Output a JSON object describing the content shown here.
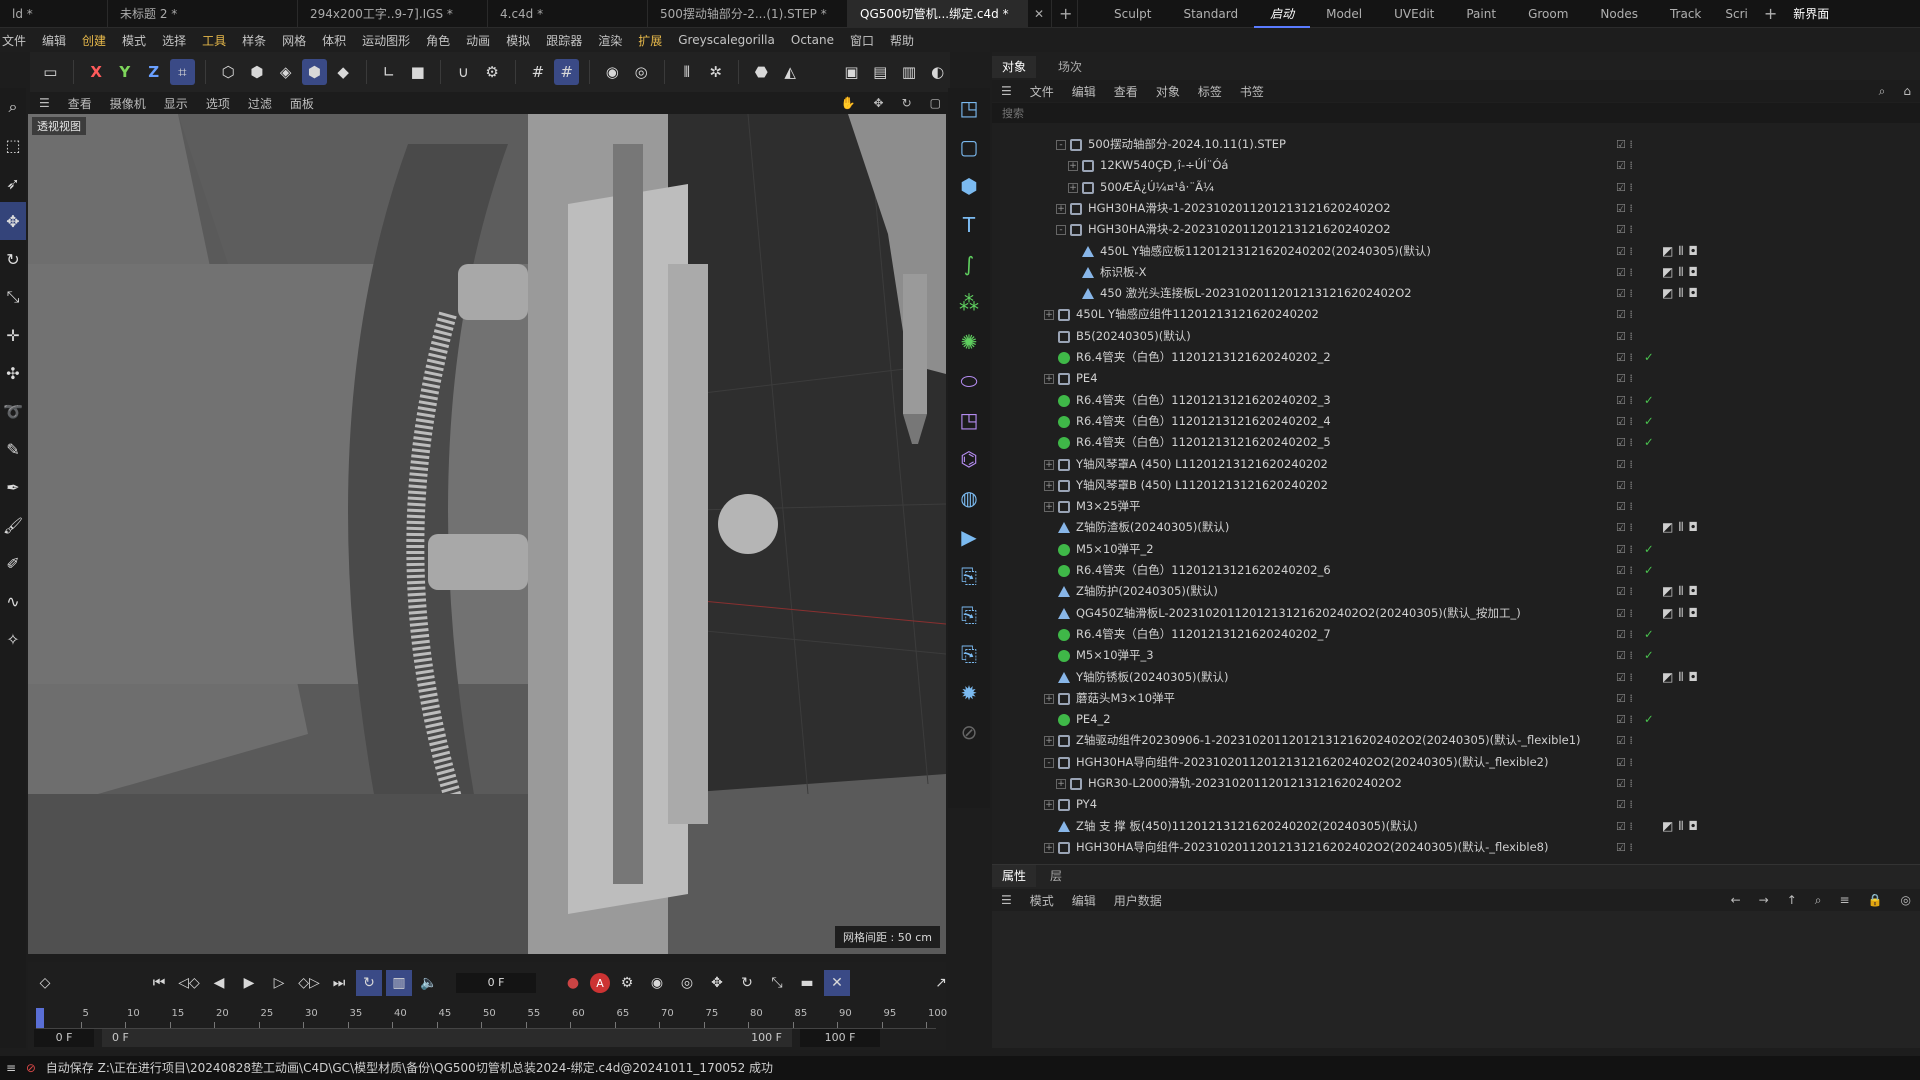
{
  "tabs": [
    "ld *",
    "未标题 2 *",
    "294x200工字..9-7].IGS *",
    "4.c4d *",
    "500摆动轴部分-2...(1).STEP *",
    "QG500切管机...绑定.c4d *"
  ],
  "active_tab": 5,
  "layouts": [
    "Sculpt",
    "Standard",
    "启动",
    "Model",
    "UVEdit",
    "Paint",
    "Groom",
    "Nodes",
    "Track",
    "Scri"
  ],
  "active_layout": 2,
  "new_layout": "新界面",
  "menu": [
    "文件",
    "编辑",
    "创建",
    "模式",
    "选择",
    "工具",
    "样条",
    "网格",
    "体积",
    "运动图形",
    "角色",
    "动画",
    "模拟",
    "跟踪器",
    "渲染",
    "扩展",
    "Greyscalegorilla",
    "Octane",
    "窗口",
    "帮助"
  ],
  "menu_highlight": [
    2,
    5,
    15
  ],
  "toolbar_axes": [
    "X",
    "Y",
    "Z"
  ],
  "viewport_menu": [
    "查看",
    "摄像机",
    "显示",
    "选项",
    "过滤",
    "面板"
  ],
  "viewport": {
    "label": "透视视图",
    "grid": "网格间距 : 50 cm"
  },
  "timeline": {
    "frame": "0 F",
    "ruler": [
      "0",
      "5",
      "10",
      "15",
      "20",
      "25",
      "30",
      "35",
      "40",
      "45",
      "50",
      "55",
      "60",
      "65",
      "70",
      "75",
      "80",
      "85",
      "90",
      "95",
      "100"
    ],
    "start": "0 F",
    "preview_start": "0 F",
    "preview_end": "100 F",
    "end": "100 F"
  },
  "object_manager": {
    "tabs": [
      "对象",
      "场次"
    ],
    "menu": [
      "文件",
      "编辑",
      "查看",
      "对象",
      "标签",
      "书签"
    ],
    "search_placeholder": "搜索",
    "rows": [
      {
        "name": "500摆动轴部分-2024.10.11(1).STEP",
        "level": 1,
        "icon": "null",
        "exp": "-",
        "check": false,
        "tags": false
      },
      {
        "name": "12KW540ÇÐ¸î-÷ÚÍ¨Óá",
        "level": 2,
        "icon": "null",
        "exp": "+",
        "check": false,
        "tags": false
      },
      {
        "name": "500ÆÄ¿Ú¼¤¹â·¨Ã¼",
        "level": 2,
        "icon": "null",
        "exp": "+",
        "check": false,
        "tags": false
      },
      {
        "name": "HGH30HA滑块-1-20231020112012131216202402O2",
        "level": 1,
        "icon": "null",
        "exp": "+",
        "check": false,
        "tags": false
      },
      {
        "name": "HGH30HA滑块-2-20231020112012131216202402O2",
        "level": 1,
        "icon": "null",
        "exp": "-",
        "check": false,
        "tags": false
      },
      {
        "name": "450L Y轴感应板11201213121620240202(20240305)(默认)",
        "level": 2,
        "icon": "joint",
        "exp": "",
        "check": false,
        "tags": true
      },
      {
        "name": "标识板-X",
        "level": 2,
        "icon": "joint",
        "exp": "",
        "check": false,
        "tags": true
      },
      {
        "name": "450 激光头连接板L-20231020112012131216202402O2",
        "level": 2,
        "icon": "joint",
        "exp": "",
        "check": false,
        "tags": true
      },
      {
        "name": "450L Y轴感应组件11201213121620240202",
        "level": 0,
        "icon": "null",
        "exp": "+",
        "check": false,
        "tags": false
      },
      {
        "name": "B5(20240305)(默认)",
        "level": 0,
        "icon": "null",
        "exp": "",
        "check": false,
        "tags": false
      },
      {
        "name": "R6.4管夹（白色）11201213121620240202_2",
        "level": 0,
        "icon": "poly",
        "exp": "",
        "check": true,
        "tags": false
      },
      {
        "name": "PE4",
        "level": 0,
        "icon": "null",
        "exp": "+",
        "check": false,
        "tags": false
      },
      {
        "name": "R6.4管夹（白色）11201213121620240202_3",
        "level": 0,
        "icon": "poly",
        "exp": "",
        "check": true,
        "tags": false
      },
      {
        "name": "R6.4管夹（白色）11201213121620240202_4",
        "level": 0,
        "icon": "poly",
        "exp": "",
        "check": true,
        "tags": false
      },
      {
        "name": "R6.4管夹（白色）11201213121620240202_5",
        "level": 0,
        "icon": "poly",
        "exp": "",
        "check": true,
        "tags": false
      },
      {
        "name": "Y轴风琴罩A (450) L11201213121620240202",
        "level": 0,
        "icon": "null",
        "exp": "+",
        "check": false,
        "tags": false
      },
      {
        "name": "Y轴风琴罩B (450) L11201213121620240202",
        "level": 0,
        "icon": "null",
        "exp": "+",
        "check": false,
        "tags": false
      },
      {
        "name": "M3×25弹平",
        "level": 0,
        "icon": "null",
        "exp": "+",
        "check": false,
        "tags": false
      },
      {
        "name": "Z轴防渣板(20240305)(默认)",
        "level": 0,
        "icon": "joint",
        "exp": "",
        "check": false,
        "tags": true
      },
      {
        "name": "M5×10弹平_2",
        "level": 0,
        "icon": "poly",
        "exp": "",
        "check": true,
        "tags": false
      },
      {
        "name": "R6.4管夹（白色）11201213121620240202_6",
        "level": 0,
        "icon": "poly",
        "exp": "",
        "check": true,
        "tags": false
      },
      {
        "name": "Z轴防护(20240305)(默认)",
        "level": 0,
        "icon": "joint",
        "exp": "",
        "check": false,
        "tags": true
      },
      {
        "name": "QG450Z轴滑板L-20231020112012131216202402O2(20240305)(默认_按加工_)",
        "level": 0,
        "icon": "joint",
        "exp": "",
        "check": false,
        "tags": true
      },
      {
        "name": "R6.4管夹（白色）11201213121620240202_7",
        "level": 0,
        "icon": "poly",
        "exp": "",
        "check": true,
        "tags": false
      },
      {
        "name": "M5×10弹平_3",
        "level": 0,
        "icon": "poly",
        "exp": "",
        "check": true,
        "tags": false
      },
      {
        "name": "Y轴防锈板(20240305)(默认)",
        "level": 0,
        "icon": "joint",
        "exp": "",
        "check": false,
        "tags": true
      },
      {
        "name": "蘑菇头M3×10弹平",
        "level": 0,
        "icon": "null",
        "exp": "+",
        "check": false,
        "tags": false
      },
      {
        "name": "PE4_2",
        "level": 0,
        "icon": "poly",
        "exp": "",
        "check": true,
        "tags": false
      },
      {
        "name": "Z轴驱动组件20230906-1-20231020112012131216202402O2(20240305)(默认-_flexible1)",
        "level": 0,
        "icon": "null",
        "exp": "+",
        "check": false,
        "tags": false
      },
      {
        "name": "HGH30HA导向组件-20231020112012131216202402O2(20240305)(默认-_flexible2)",
        "level": 0,
        "icon": "null",
        "exp": "-",
        "check": false,
        "tags": false
      },
      {
        "name": "HGR30-L2000滑轨-20231020112012131216202402O2",
        "level": 1,
        "icon": "null",
        "exp": "+",
        "check": false,
        "tags": false
      },
      {
        "name": "PY4",
        "level": 0,
        "icon": "null",
        "exp": "+",
        "check": false,
        "tags": false
      },
      {
        "name": "Z轴 支 撑 板(450)11201213121620240202(20240305)(默认)",
        "level": 0,
        "icon": "joint",
        "exp": "",
        "check": false,
        "tags": true
      },
      {
        "name": "HGH30HA导向组件-20231020112012131216202402O2(20240305)(默认-_flexible8)",
        "level": 0,
        "icon": "null",
        "exp": "+",
        "check": false,
        "tags": false
      }
    ]
  },
  "attribute_manager": {
    "tabs": [
      "属性",
      "层"
    ],
    "menu": [
      "模式",
      "编辑",
      "用户数据"
    ]
  },
  "status": "自动保存 Z:\\正在进行项目\\20240828垫工动画\\C4D\\GC\\模型材质\\备份\\QG500切管机总装2024-绑定.c4d@20241011_170052 成功",
  "colors": {
    "accent": "#3a4a86",
    "check": "#49c24e",
    "highlight_menu": "#e6b84a",
    "icon_blue": "#7bbaf0"
  }
}
